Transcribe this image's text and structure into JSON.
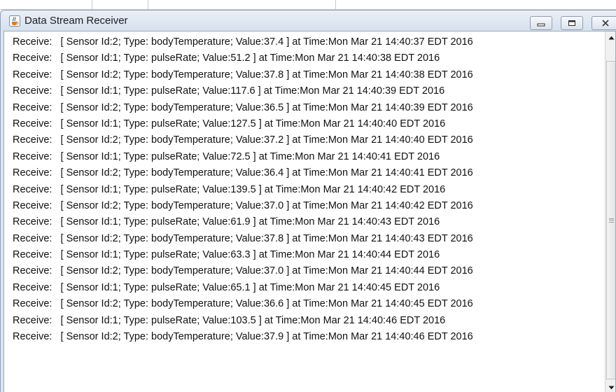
{
  "window": {
    "title": "Data Stream Receiver",
    "icon": "java-cup-icon",
    "controls": [
      "minimize-icon",
      "maximize-icon",
      "close-icon"
    ]
  },
  "log": {
    "prefix": "Receive:",
    "lines": [
      "[ Sensor Id:2; Type: bodyTemperature; Value:37.4 ] at Time:Mon Mar 21 14:40:37 EDT 2016",
      "[ Sensor Id:1; Type: pulseRate; Value:51.2 ] at Time:Mon Mar 21 14:40:38 EDT 2016",
      "[ Sensor Id:2; Type: bodyTemperature; Value:37.8 ] at Time:Mon Mar 21 14:40:38 EDT 2016",
      "[ Sensor Id:1; Type: pulseRate; Value:117.6 ] at Time:Mon Mar 21 14:40:39 EDT 2016",
      "[ Sensor Id:2; Type: bodyTemperature; Value:36.5 ] at Time:Mon Mar 21 14:40:39 EDT 2016",
      "[ Sensor Id:1; Type: pulseRate; Value:127.5 ] at Time:Mon Mar 21 14:40:40 EDT 2016",
      "[ Sensor Id:2; Type: bodyTemperature; Value:37.2 ] at Time:Mon Mar 21 14:40:40 EDT 2016",
      "[ Sensor Id:1; Type: pulseRate; Value:72.5 ] at Time:Mon Mar 21 14:40:41 EDT 2016",
      "[ Sensor Id:2; Type: bodyTemperature; Value:36.4 ] at Time:Mon Mar 21 14:40:41 EDT 2016",
      "[ Sensor Id:1; Type: pulseRate; Value:139.5 ] at Time:Mon Mar 21 14:40:42 EDT 2016",
      "[ Sensor Id:2; Type: bodyTemperature; Value:37.0 ] at Time:Mon Mar 21 14:40:42 EDT 2016",
      "[ Sensor Id:1; Type: pulseRate; Value:61.9 ] at Time:Mon Mar 21 14:40:43 EDT 2016",
      "[ Sensor Id:2; Type: bodyTemperature; Value:37.8 ] at Time:Mon Mar 21 14:40:43 EDT 2016",
      "[ Sensor Id:1; Type: pulseRate; Value:63.3 ] at Time:Mon Mar 21 14:40:44 EDT 2016",
      "[ Sensor Id:2; Type: bodyTemperature; Value:37.0 ] at Time:Mon Mar 21 14:40:44 EDT 2016",
      "[ Sensor Id:1; Type: pulseRate; Value:65.1 ] at Time:Mon Mar 21 14:40:45 EDT 2016",
      "[ Sensor Id:2; Type: bodyTemperature; Value:36.6 ] at Time:Mon Mar 21 14:40:45 EDT 2016",
      "[ Sensor Id:1; Type: pulseRate; Value:103.5 ] at Time:Mon Mar 21 14:40:46 EDT 2016",
      "[ Sensor Id:2; Type: bodyTemperature; Value:37.9 ] at Time:Mon Mar 21 14:40:46 EDT 2016"
    ]
  },
  "scrollbar": {
    "up_icon": "arrow-up-icon",
    "down_icon": "arrow-down-icon",
    "grip_icon": "grip-icon"
  },
  "colors": {
    "titlebar": "#dde6f1",
    "text": "#111111",
    "content_bg": "#ffffff"
  }
}
